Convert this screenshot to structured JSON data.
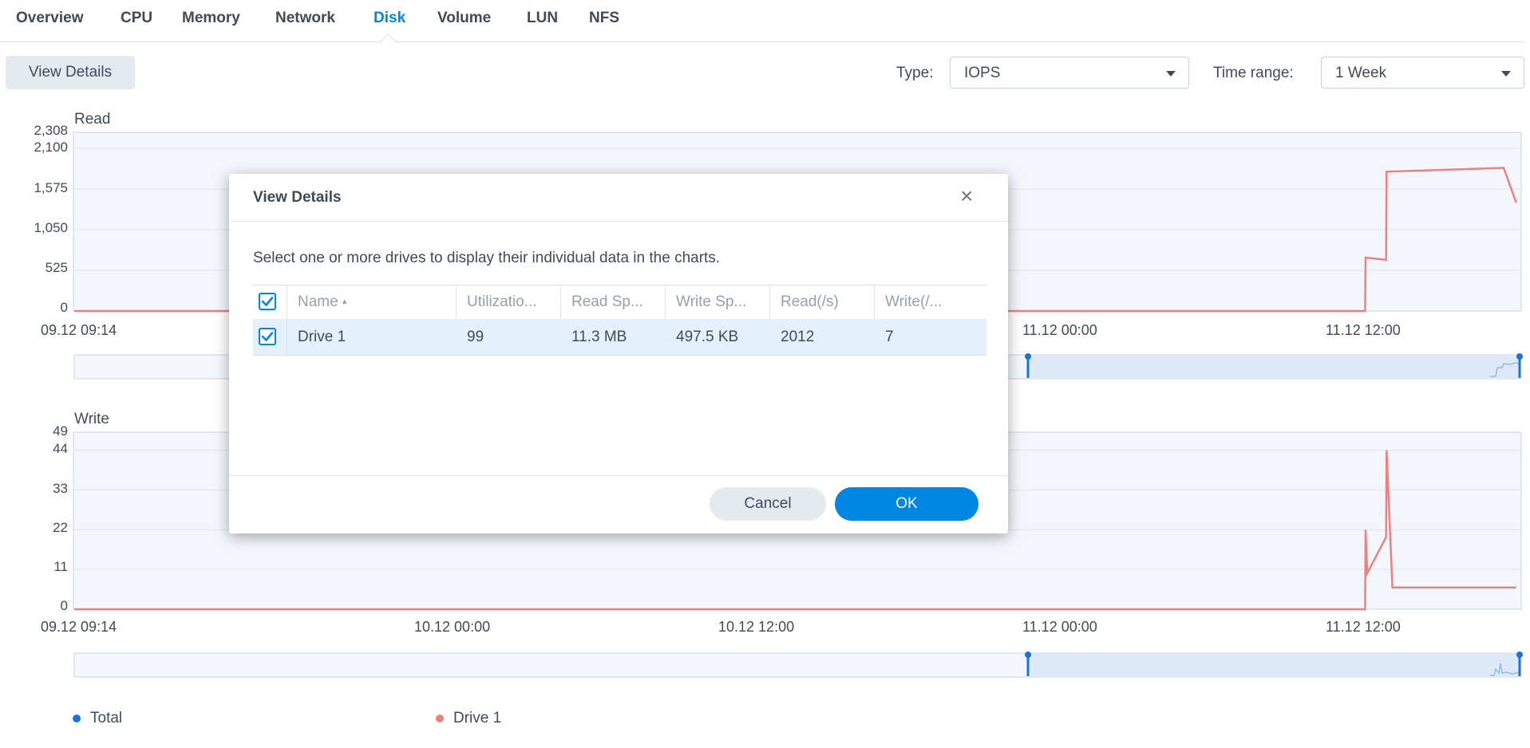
{
  "tabs": [
    {
      "label": "Overview"
    },
    {
      "label": "CPU"
    },
    {
      "label": "Memory"
    },
    {
      "label": "Network"
    },
    {
      "label": "Disk",
      "active": true
    },
    {
      "label": "Volume"
    },
    {
      "label": "LUN"
    },
    {
      "label": "NFS"
    }
  ],
  "toolbar": {
    "view_details_label": "View Details",
    "type_label": "Type:",
    "type_value": "IOPS",
    "time_range_label": "Time range:",
    "time_range_value": "1 Week"
  },
  "colors": {
    "accent": "#0086e5",
    "drive_series": "#f08080",
    "total_series": "#1a73d9",
    "plot_bg": "#f3f7fc",
    "selected_range": "#dde9f9"
  },
  "chart_data": [
    {
      "type": "line",
      "title": "Read",
      "y_ticks": [
        "2,308",
        "2,100",
        "1,575",
        "1,050",
        "525",
        "0"
      ],
      "x_ticks": [
        "09.12 09:14",
        "10.12 00:00",
        "10.12 12:00",
        "11.12 00:00",
        "11.12 12:00"
      ],
      "ylim": [
        0,
        2308
      ],
      "series": [
        {
          "name": "Drive 1",
          "points": [
            [
              "09.12 09:14",
              0
            ],
            [
              "11.12 12:00",
              0
            ],
            [
              "11.12 12:30",
              0
            ],
            [
              "11.12 12:31",
              690
            ],
            [
              "11.12 13:20",
              660
            ],
            [
              "11.12 13:21",
              1800
            ],
            [
              "11.12 18:00",
              1850
            ],
            [
              "11.12 18:30",
              1400
            ]
          ]
        }
      ]
    },
    {
      "type": "line",
      "title": "Write",
      "y_ticks": [
        "49",
        "44",
        "33",
        "22",
        "11",
        "0"
      ],
      "x_ticks": [
        "09.12 09:14",
        "10.12 00:00",
        "10.12 12:00",
        "11.12 00:00",
        "11.12 12:00"
      ],
      "ylim": [
        0,
        49
      ],
      "series": [
        {
          "name": "Drive 1",
          "points": [
            [
              "09.12 09:14",
              0
            ],
            [
              "11.12 12:30",
              0
            ],
            [
              "11.12 12:31",
              22
            ],
            [
              "11.12 12:35",
              10
            ],
            [
              "11.12 13:20",
              20
            ],
            [
              "11.12 13:21",
              44
            ],
            [
              "11.12 13:35",
              6
            ],
            [
              "11.12 18:30",
              6
            ]
          ]
        }
      ]
    }
  ],
  "legend": [
    {
      "name": "Total",
      "color": "#1a73d9"
    },
    {
      "name": "Drive 1",
      "color": "#f08080"
    }
  ],
  "dialog": {
    "title": "View Details",
    "close_glyph": "×",
    "description": "Select one or more drives to display their individual data in the charts.",
    "columns": [
      "Name",
      "Utilizatio...",
      "Read Sp...",
      "Write Sp...",
      "Read(/s)",
      "Write(/..."
    ],
    "sort_glyph": "▴",
    "rows": [
      {
        "name": "Drive 1",
        "utilization": "99",
        "read_speed": "11.3 MB",
        "write_speed": "497.5 KB",
        "read_iops": "2012",
        "write_iops": "7",
        "checked": true
      }
    ],
    "cancel_label": "Cancel",
    "ok_label": "OK"
  }
}
